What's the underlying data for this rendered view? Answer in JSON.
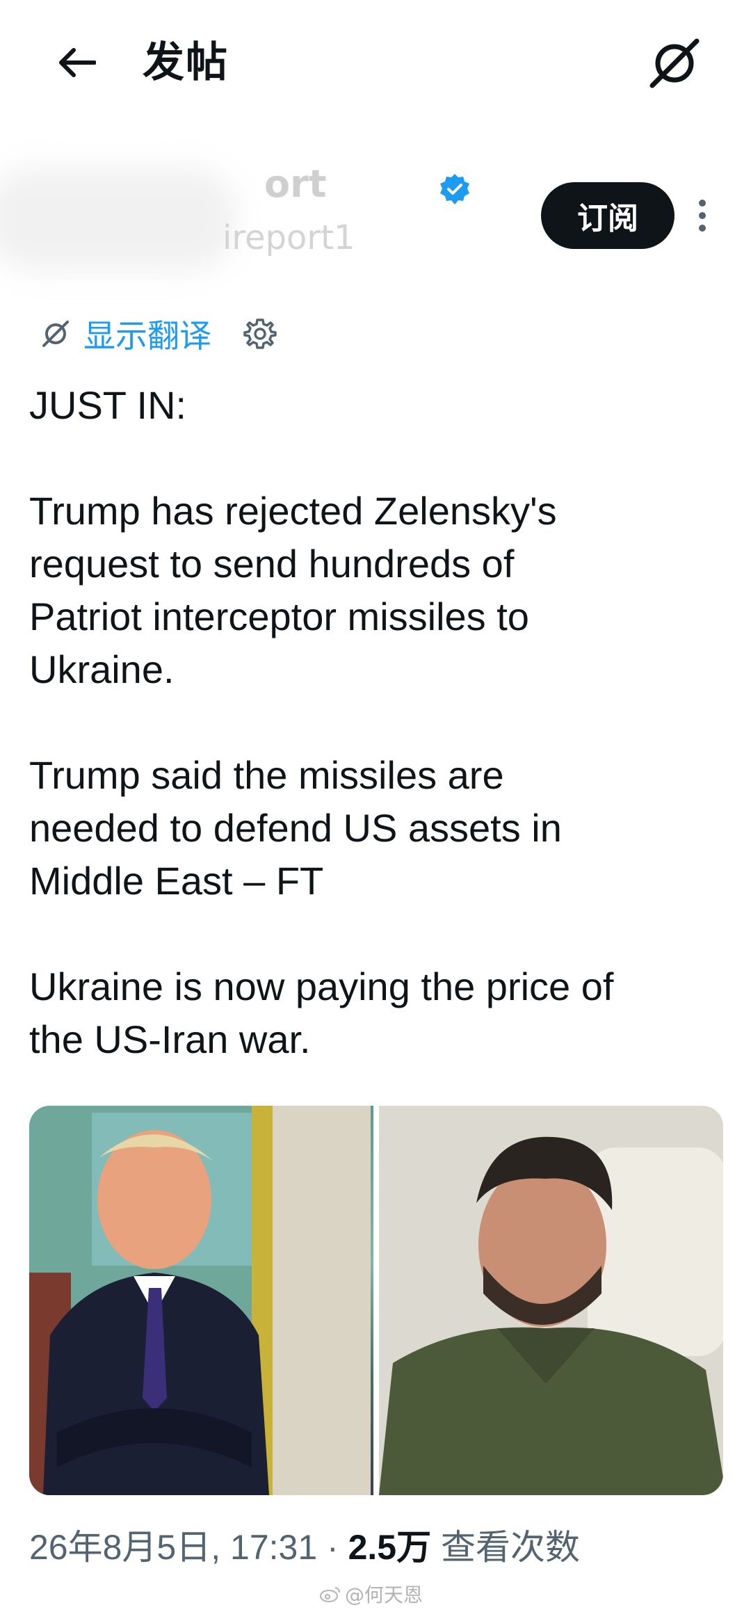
{
  "header": {
    "title": "发帖"
  },
  "author": {
    "display_name": "ort",
    "handle": "ireport1",
    "subscribe_label": "订阅"
  },
  "translate": {
    "label": "显示翻译"
  },
  "post": {
    "paragraphs": [
      "JUST IN:",
      "Trump has rejected Zelensky's\nrequest to send hundreds of\nPatriot interceptor missiles to\nUkraine.",
      "Trump said the missiles are\nneeded to defend US assets in\nMiddle East – FT",
      "Ukraine is now paying the price of\nthe US-Iran war."
    ]
  },
  "meta": {
    "timestamp": "26年8月5日, 17:31",
    "separator": " · ",
    "views_count": "2.5万",
    "views_label": " 查看次数"
  },
  "watermark": {
    "text": "@何天恩"
  },
  "colors": {
    "accent": "#1d9bf0",
    "text": "#0f1419",
    "muted": "#536471",
    "button_bg": "#0f1419"
  }
}
